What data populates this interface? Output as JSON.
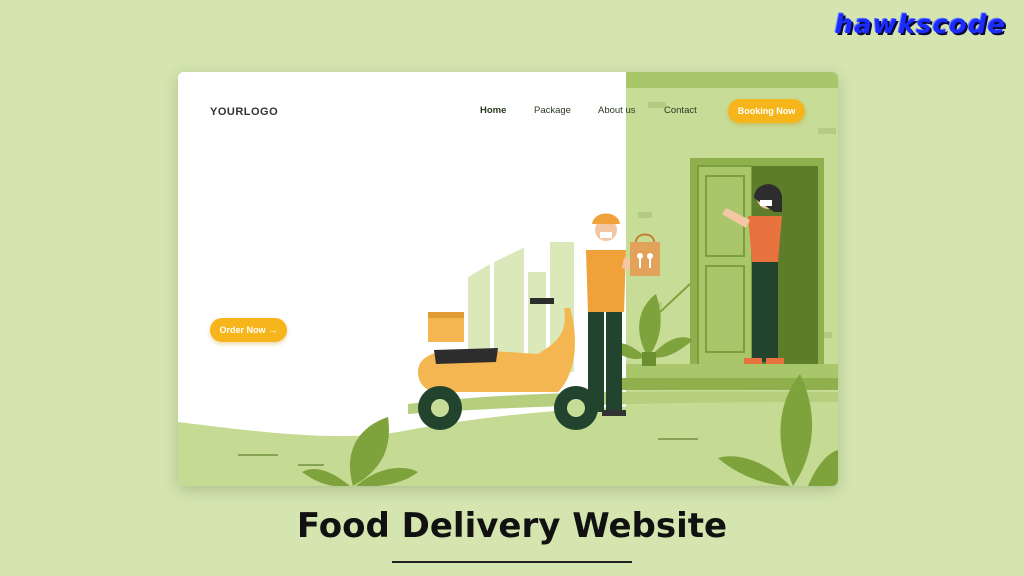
{
  "brand": {
    "name": "hawkscode"
  },
  "site": {
    "logo": "YOURLOGO",
    "nav": [
      {
        "label": "Home"
      },
      {
        "label": "Package"
      },
      {
        "label": "About us"
      },
      {
        "label": "Contact"
      }
    ],
    "booking_label": "Booking Now",
    "order_label": "Order Now",
    "order_icon": "arrow-right-icon",
    "accent_color": "#f7b51c",
    "theme_green": "#a9c76a"
  },
  "caption": "Food Delivery Website"
}
